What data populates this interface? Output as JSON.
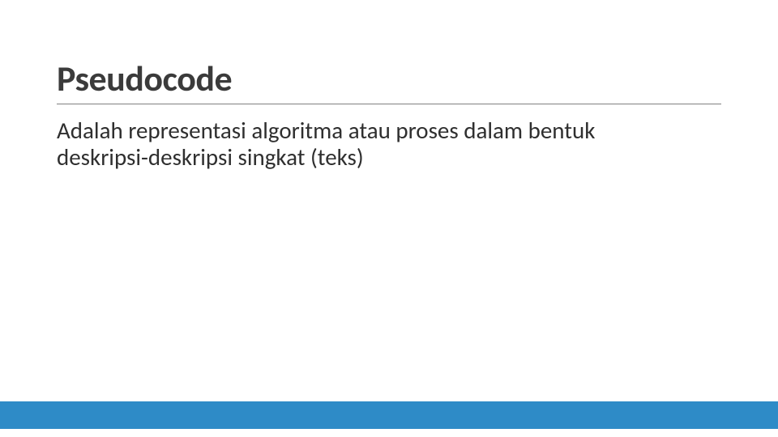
{
  "slide": {
    "title": "Pseudocode",
    "body": "Adalah representasi algoritma atau proses dalam bentuk deskripsi-deskripsi singkat (teks)"
  },
  "theme": {
    "accent": "#2e8bc7",
    "titleColor": "#3b3b3b",
    "bodyColor": "#2f2f2f",
    "ruleColor": "#7f7f7f"
  }
}
